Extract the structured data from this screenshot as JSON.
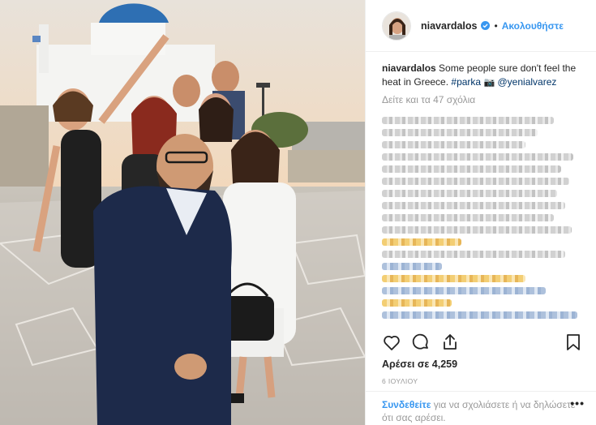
{
  "post": {
    "username": "niavardalos",
    "follow_label": "Ακολουθήστε",
    "separator": "•",
    "caption": {
      "username": "niavardalos",
      "text": "Some people sure don't feel the heat in Greece.",
      "hashtag": "#parka",
      "camera_emoji": "📷",
      "mention": "@yenialvarez"
    },
    "view_all_comments": "Δείτε και τα 47 σχόλια",
    "likes": "Αρέσει σε 4,259",
    "date": "6 ΙΟΥΛΙΟΥ",
    "footer": {
      "login_link": "Συνδεθείτε",
      "rest": "για να σχολιάσετε ή να δηλώσετε ότι σας αρέσει.",
      "more": "•••"
    }
  },
  "icons": {
    "verified": "verified-badge-icon",
    "like": "heart-icon",
    "comment": "comment-bubble-icon",
    "share": "share-icon",
    "save": "bookmark-icon"
  },
  "colors": {
    "link_blue": "#3897f0",
    "hashtag_blue": "#003569",
    "muted_gray": "#999999",
    "text_dark": "#262626"
  }
}
